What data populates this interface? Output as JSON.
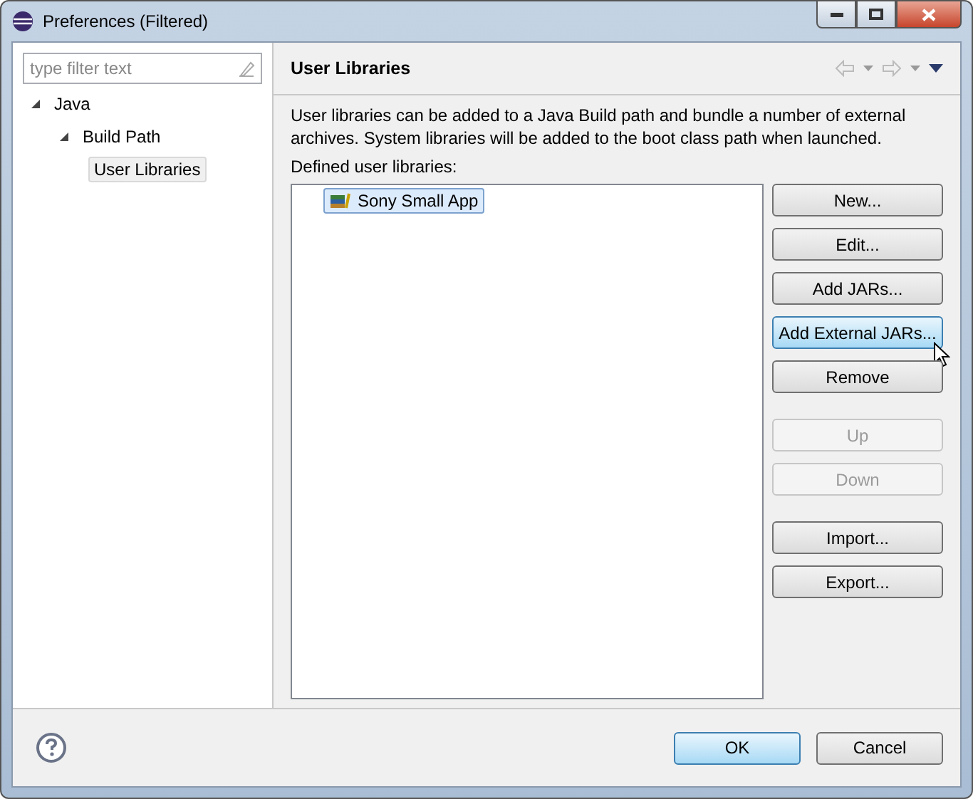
{
  "window": {
    "title": "Preferences (Filtered)"
  },
  "filter": {
    "placeholder": "type filter text"
  },
  "tree": [
    {
      "label": "Java",
      "expanded": true,
      "selected": false,
      "children": [
        {
          "label": "Build Path",
          "expanded": true,
          "selected": false,
          "children": [
            {
              "label": "User Libraries",
              "selected": true
            }
          ]
        }
      ]
    }
  ],
  "page": {
    "title": "User Libraries",
    "description": "User libraries can be added to a Java Build path and bundle a number of external archives. System libraries will be added to the boot class path when launched.",
    "list_label": "Defined user libraries:"
  },
  "libraries": [
    {
      "label": "Sony Small App",
      "selected": true
    }
  ],
  "button_groups": [
    [
      {
        "label": "New...",
        "disabled": false,
        "hovered": false
      },
      {
        "label": "Edit...",
        "disabled": false,
        "hovered": false
      },
      {
        "label": "Add JARs...",
        "disabled": false,
        "hovered": false
      },
      {
        "label": "Add External JARs...",
        "disabled": false,
        "hovered": true
      },
      {
        "label": "Remove",
        "disabled": false,
        "hovered": false
      }
    ],
    [
      {
        "label": "Up",
        "disabled": true,
        "hovered": false
      },
      {
        "label": "Down",
        "disabled": true,
        "hovered": false
      }
    ],
    [
      {
        "label": "Import...",
        "disabled": false,
        "hovered": false
      },
      {
        "label": "Export...",
        "disabled": false,
        "hovered": false
      }
    ]
  ],
  "footer": [
    {
      "label": "OK",
      "default": true
    },
    {
      "label": "Cancel",
      "default": false
    }
  ]
}
